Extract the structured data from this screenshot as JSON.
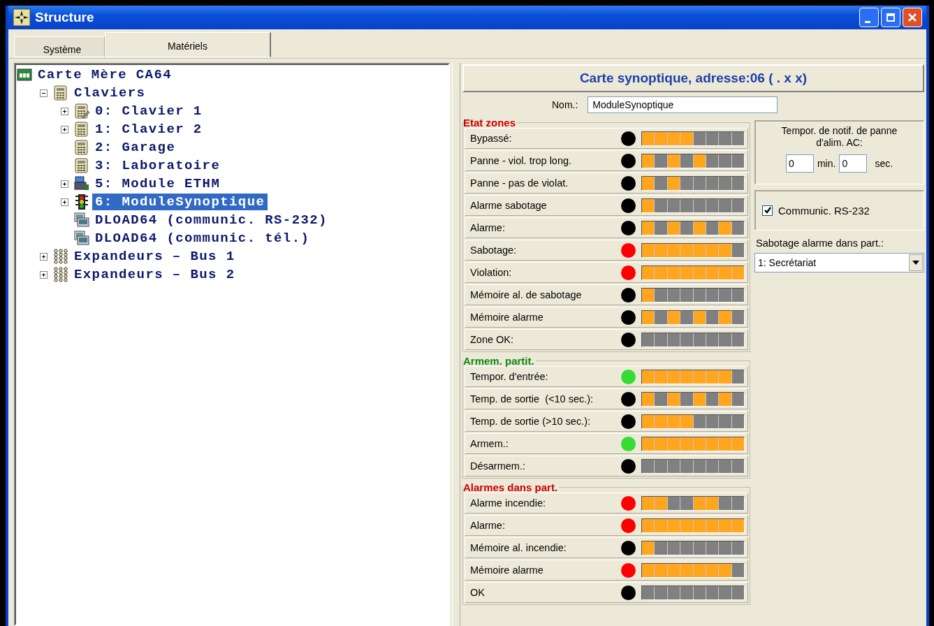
{
  "window": {
    "title": "Structure"
  },
  "tabs": [
    {
      "label": "Système",
      "selected": false
    },
    {
      "label": "Matériels",
      "selected": true
    }
  ],
  "tree": [
    {
      "label": "Carte Mère CA64",
      "kind": "board",
      "selected": false,
      "children": [
        {
          "label": "Claviers",
          "kind": "keypad",
          "expanded": true,
          "selected": false,
          "children": [
            {
              "label": "0: Clavier 1",
              "kind": "keypad-edit",
              "expanded": false,
              "selected": false
            },
            {
              "label": "1: Clavier 2",
              "kind": "keypad",
              "expanded": false,
              "selected": false
            },
            {
              "label": "2: Garage",
              "kind": "keypad",
              "selected": false
            },
            {
              "label": "3: Laboratoire",
              "kind": "keypad",
              "selected": false
            },
            {
              "label": "5: Module ETHM",
              "kind": "network",
              "expanded": false,
              "selected": false
            },
            {
              "label": "6: ModuleSynoptique",
              "kind": "traffic-light",
              "expanded": false,
              "selected": true
            },
            {
              "label": "DLOAD64 (communic. RS-232)",
              "kind": "computer",
              "selected": false
            },
            {
              "label": "DLOAD64 (communic. tél.)",
              "kind": "computer",
              "selected": false
            }
          ]
        },
        {
          "label": "Expandeurs – Bus 1",
          "kind": "expander",
          "expanded": false,
          "selected": false
        },
        {
          "label": "Expandeurs – Bus 2",
          "kind": "expander",
          "expanded": false,
          "selected": false
        }
      ]
    }
  ],
  "panel": {
    "title": "Carte synoptique, adresse:06 ( . x x)",
    "name_label": "Nom.:",
    "name_value": "ModuleSynoptique",
    "groups": [
      {
        "title": "Etat zones",
        "color": "#cc0000",
        "rows": [
          {
            "label": "Bypassé:",
            "color": "#000000",
            "segments": [
              true,
              true,
              true,
              true,
              false,
              false,
              false,
              false
            ]
          },
          {
            "label": "Panne - viol. trop long.",
            "color": "#000000",
            "segments": [
              true,
              false,
              true,
              false,
              true,
              false,
              false,
              false
            ]
          },
          {
            "label": "Panne - pas de violat.",
            "color": "#000000",
            "segments": [
              true,
              false,
              true,
              false,
              false,
              false,
              false,
              false
            ]
          },
          {
            "label": "Alarme sabotage",
            "color": "#000000",
            "segments": [
              true,
              false,
              false,
              false,
              false,
              false,
              false,
              false
            ]
          },
          {
            "label": "Alarme:",
            "color": "#000000",
            "segments": [
              true,
              false,
              true,
              false,
              true,
              false,
              true,
              false
            ]
          },
          {
            "label": "Sabotage:",
            "color": "#ff0000",
            "segments": [
              true,
              true,
              true,
              true,
              true,
              true,
              true,
              false
            ]
          },
          {
            "label": "Violation:",
            "color": "#ff0000",
            "segments": [
              true,
              true,
              true,
              true,
              true,
              true,
              true,
              true
            ]
          },
          {
            "label": "Mémoire al. de sabotage",
            "color": "#000000",
            "segments": [
              true,
              false,
              false,
              false,
              false,
              false,
              false,
              false
            ]
          },
          {
            "label": "Mémoire alarme",
            "color": "#000000",
            "segments": [
              true,
              false,
              true,
              false,
              true,
              false,
              true,
              false
            ]
          },
          {
            "label": "Zone OK:",
            "color": "#000000",
            "segments": [
              false,
              false,
              false,
              false,
              false,
              false,
              false,
              false
            ]
          }
        ]
      },
      {
        "title": "Armem. partit.",
        "color": "#118811",
        "rows": [
          {
            "label": "Tempor. d'entrée:",
            "color": "#33dd33",
            "segments": [
              true,
              true,
              true,
              true,
              true,
              true,
              true,
              false
            ]
          },
          {
            "label": "Temp. de sortie  (<10 sec.):",
            "color": "#000000",
            "segments": [
              true,
              false,
              true,
              false,
              true,
              false,
              true,
              false
            ]
          },
          {
            "label": "Temp. de sortie (>10 sec.):",
            "color": "#000000",
            "segments": [
              true,
              true,
              true,
              true,
              false,
              false,
              false,
              false
            ]
          },
          {
            "label": "Armem.:",
            "color": "#33dd33",
            "segments": [
              true,
              true,
              true,
              true,
              true,
              true,
              true,
              true
            ]
          },
          {
            "label": "Désarmem.:",
            "color": "#000000",
            "segments": [
              false,
              false,
              false,
              false,
              false,
              false,
              false,
              false
            ]
          }
        ]
      },
      {
        "title": "Alarmes dans part.",
        "color": "#cc0000",
        "rows": [
          {
            "label": "Alarme incendie:",
            "color": "#ff0000",
            "segments": [
              true,
              true,
              false,
              false,
              true,
              true,
              false,
              false
            ]
          },
          {
            "label": "Alarme:",
            "color": "#ff0000",
            "segments": [
              true,
              true,
              true,
              true,
              true,
              true,
              true,
              true
            ]
          },
          {
            "label": "Mémoire al. incendie:",
            "color": "#000000",
            "segments": [
              true,
              false,
              false,
              false,
              false,
              false,
              false,
              false
            ]
          },
          {
            "label": "Mémoire alarme",
            "color": "#ff0000",
            "segments": [
              true,
              true,
              true,
              true,
              true,
              true,
              true,
              false
            ]
          },
          {
            "label": "OK",
            "color": "#000000",
            "segments": [
              false,
              false,
              false,
              false,
              false,
              false,
              false,
              false
            ]
          }
        ]
      }
    ],
    "ac_timer": {
      "title": "Tempor. de notif. de panne d'alim. AC:",
      "minutes": "0",
      "min_label": "min.",
      "seconds": "0",
      "sec_label": "sec."
    },
    "rs232": {
      "label": "Communic. RS-232",
      "checked": true
    },
    "tamper_partition": {
      "label": "Sabotage alarme dans part.:",
      "value": "1: Secrétariat"
    }
  }
}
